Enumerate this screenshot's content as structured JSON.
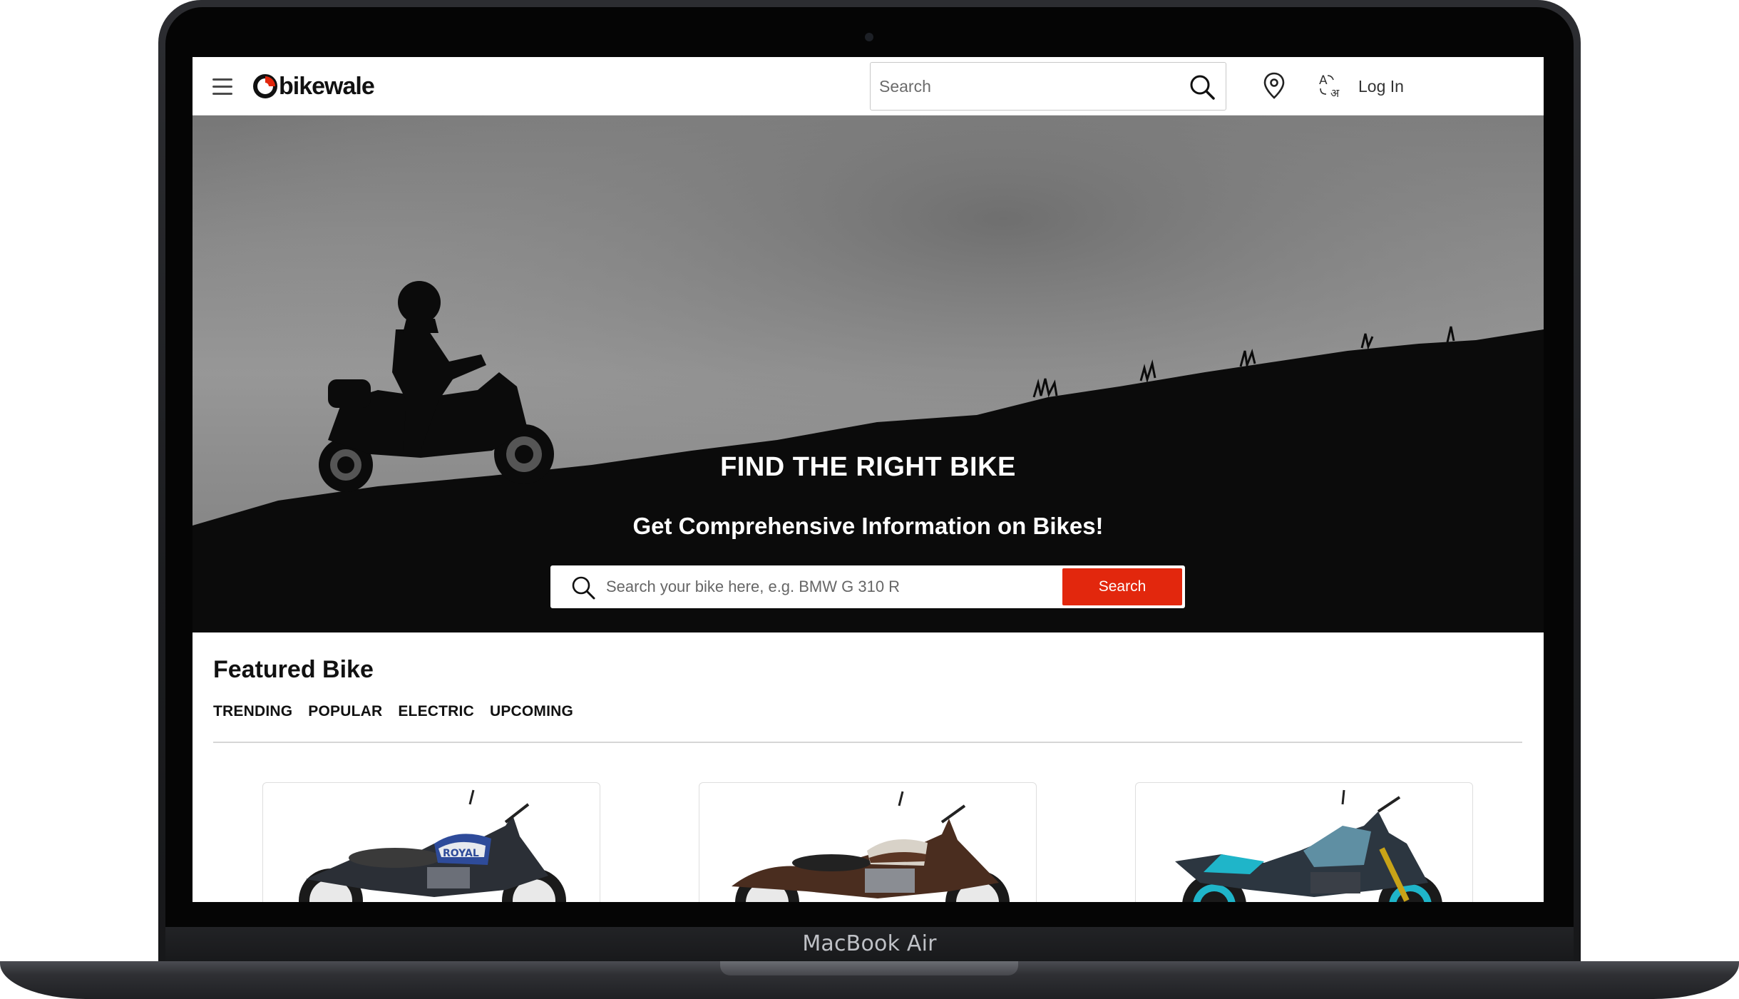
{
  "device": {
    "label": "MacBook Air"
  },
  "header": {
    "logo_text": "bikewale",
    "search_placeholder": "Search",
    "login_label": "Log In"
  },
  "hero": {
    "title": "FIND THE RIGHT BIKE",
    "subtitle": "Get Comprehensive Information on Bikes!",
    "search_placeholder": "Search your bike here, e.g. BMW G 310 R",
    "search_button": "Search"
  },
  "featured": {
    "title": "Featured Bike",
    "tabs": [
      "TRENDING",
      "POPULAR",
      "ELECTRIC",
      "UPCOMING"
    ]
  },
  "colors": {
    "brand_red": "#e2270d",
    "text_dark": "#111111"
  }
}
